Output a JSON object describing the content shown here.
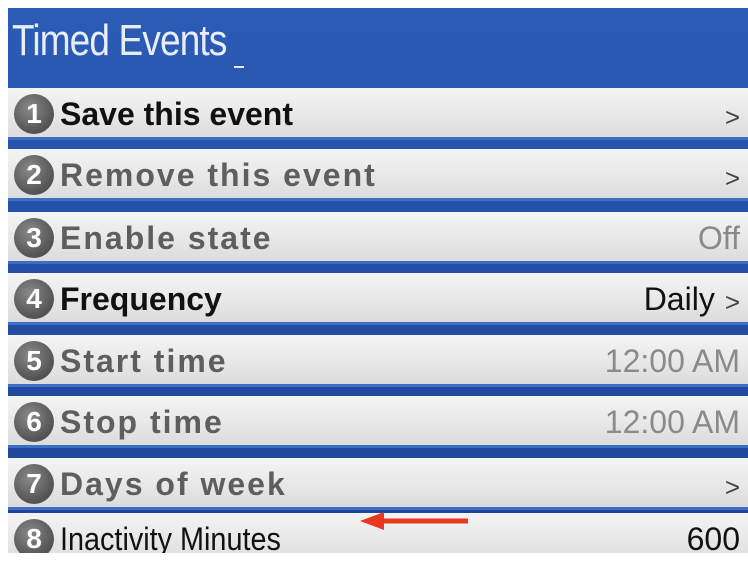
{
  "header": {
    "title": "Timed Events",
    "cursor": "_"
  },
  "menu": {
    "items": [
      {
        "number": "1",
        "label": "Save this event",
        "value": "",
        "chevron": ">",
        "state": "active"
      },
      {
        "number": "2",
        "label": "Remove this event",
        "value": "",
        "chevron": ">",
        "state": "dim"
      },
      {
        "number": "3",
        "label": "Enable state",
        "value": "Off",
        "chevron": "",
        "state": "dim"
      },
      {
        "number": "4",
        "label": "Frequency",
        "value": "Daily",
        "chevron": ">",
        "state": "active"
      },
      {
        "number": "5",
        "label": "Start time",
        "value": "12:00 AM",
        "chevron": "",
        "state": "dim"
      },
      {
        "number": "6",
        "label": "Stop time",
        "value": "12:00 AM",
        "chevron": "",
        "state": "dim"
      },
      {
        "number": "7",
        "label": "Days of week",
        "value": "",
        "chevron": ">",
        "state": "dim"
      },
      {
        "number": "8",
        "label": "Inactivity Minutes",
        "value": "600",
        "chevron": "",
        "state": "active"
      }
    ]
  },
  "colors": {
    "background": "#2550a8",
    "row": "#e9e9e9",
    "row_divider": "#3d6ec7",
    "badge": "#5a5a5a",
    "annotation_arrow": "#e8391e"
  },
  "annotation": {
    "icon": "left-arrow-icon"
  }
}
